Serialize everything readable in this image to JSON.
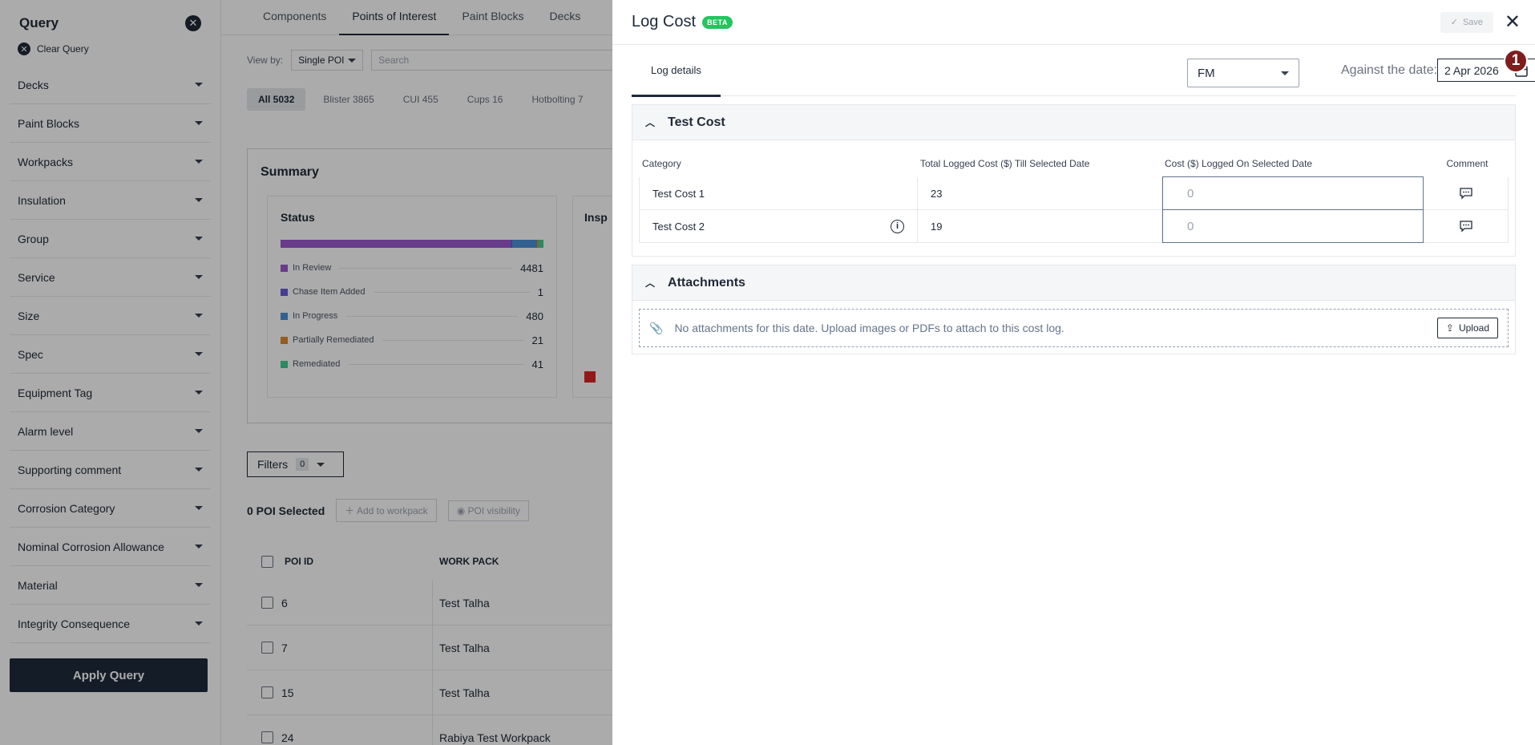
{
  "sidebar": {
    "title": "Query",
    "clear_label": "Clear Query",
    "items": [
      "Decks",
      "Paint Blocks",
      "Workpacks",
      "Insulation",
      "Group",
      "Service",
      "Size",
      "Spec",
      "Equipment Tag",
      "Alarm level",
      "Supporting comment",
      "Corrosion Category",
      "Nominal Corrosion Allowance",
      "Material",
      "Integrity Consequence"
    ],
    "apply_label": "Apply Query"
  },
  "main": {
    "tabs": [
      "Components",
      "Points of Interest",
      "Paint Blocks",
      "Decks"
    ],
    "active_tab": "Points of Interest",
    "view_by_label": "View by:",
    "view_by_value": "Single POI",
    "search_placeholder": "Search",
    "chips": [
      "All 5032",
      "Blister 3865",
      "CUI 455",
      "Cups 16",
      "Hotbolting 7"
    ],
    "summary_title": "Summary",
    "status": {
      "title": "Status",
      "legend": [
        {
          "label": "In Review",
          "count": "4481",
          "color": "#9b59d0"
        },
        {
          "label": "Chase Item Added",
          "count": "1",
          "color": "#6b5bd6"
        },
        {
          "label": "In Progress",
          "count": "480",
          "color": "#4a8fd8"
        },
        {
          "label": "Partially Remediated",
          "count": "21",
          "color": "#e0892b"
        },
        {
          "label": "Remediated",
          "count": "41",
          "color": "#3ecf8e"
        }
      ]
    },
    "inspection_title": "Insp",
    "filters_label": "Filters",
    "filters_count": "0",
    "poi_selected": "0 POI Selected",
    "add_to_workpack": "Add to workpack",
    "poi_visibility": "POI visibility",
    "table": {
      "headers": [
        "POI ID",
        "WORK PACK"
      ],
      "rows": [
        {
          "id": "6",
          "workpack": "Test Talha"
        },
        {
          "id": "7",
          "workpack": "Test Talha"
        },
        {
          "id": "15",
          "workpack": "Test Talha"
        },
        {
          "id": "24",
          "workpack": "Rabiya Test Workpack"
        }
      ]
    }
  },
  "panel": {
    "title": "Log Cost",
    "badge": "BETA",
    "save_label": "Save",
    "subtab": "Log details",
    "select_value": "FM",
    "date_label": "Against the date:",
    "date_value": "2 Apr 2026",
    "step_badge": "1",
    "cost_section": {
      "title": "Test Cost",
      "headers": [
        "Category",
        "Total Logged Cost ($) Till Selected Date",
        "Cost ($) Logged On Selected Date",
        "Comment"
      ],
      "rows": [
        {
          "category": "Test Cost 1",
          "total": "23",
          "placeholder": "0"
        },
        {
          "category": "Test Cost 2",
          "total": "19",
          "placeholder": "0"
        }
      ]
    },
    "attachments": {
      "title": "Attachments",
      "empty_text": "No attachments for this date. Upload images or PDFs to attach to this cost log.",
      "upload_label": "Upload"
    }
  }
}
